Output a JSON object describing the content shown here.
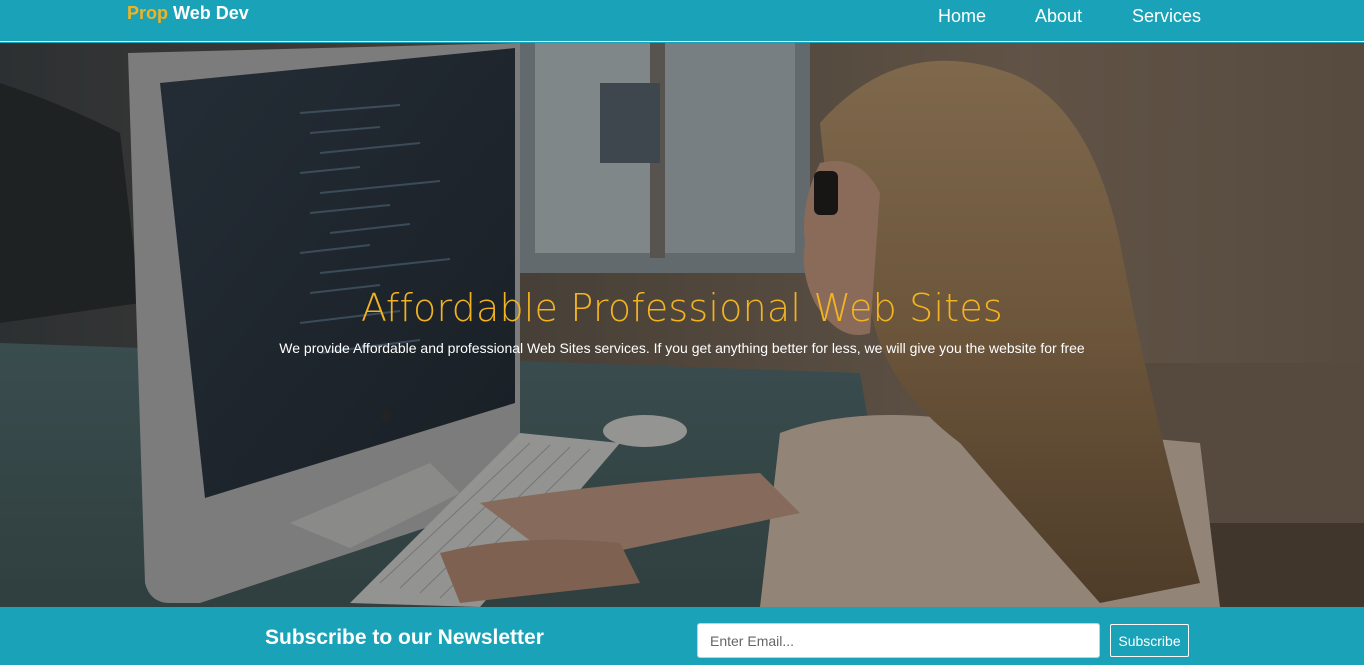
{
  "header": {
    "brand_accent": "Prop",
    "brand_rest": "Web Dev",
    "nav": [
      {
        "label": "Home"
      },
      {
        "label": "About"
      },
      {
        "label": "Services"
      }
    ]
  },
  "hero": {
    "title": "Affordable Professional Web Sites",
    "subtitle": "We provide Affordable and professional Web Sites services. If you get anything better for less, we will give you the website for free",
    "image_description": "woman-at-computer-coding-photo"
  },
  "newsletter": {
    "title": "Subscribe to our Newsletter",
    "email_placeholder": "Enter Email...",
    "email_value": "",
    "button_label": "Subscribe"
  },
  "colors": {
    "primary": "#1aa3b8",
    "accent": "#f3b320",
    "text_light": "#ffffff"
  }
}
